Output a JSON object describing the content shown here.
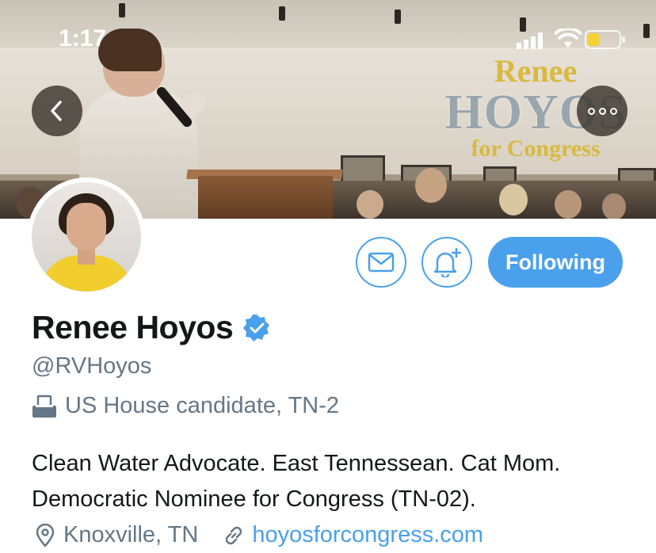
{
  "status_bar": {
    "time": "1:17"
  },
  "banner": {
    "logo_line1": "Renee",
    "logo_line2": "HOYOS",
    "logo_line3": "for Congress"
  },
  "profile": {
    "display_name": "Renee Hoyos",
    "handle": "@RVHoyos",
    "category": "US House candidate, TN-2",
    "bio_line1": "Clean Water Advocate. East Tennessean. Cat Mom.",
    "bio_line2": "Democratic Nominee for Congress (TN-02).",
    "location": "Knoxville, TN",
    "website": "hoyosforcongress.com"
  },
  "actions": {
    "follow_label": "Following"
  },
  "icons": {
    "back": "chevron-left-icon",
    "more": "more-icon",
    "message": "envelope-icon",
    "notifications": "bell-plus-icon",
    "verified": "verified-badge-icon",
    "category": "ballot-box-icon",
    "location": "location-pin-icon",
    "link": "link-icon"
  },
  "colors": {
    "accent": "#4aa0eb",
    "secondary_text": "#657786",
    "primary_text": "#14171a",
    "battery_fill": "#f5d133"
  }
}
